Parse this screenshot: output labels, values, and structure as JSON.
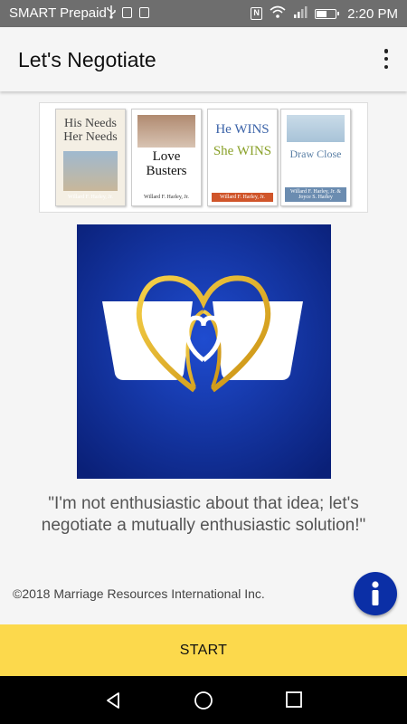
{
  "status_bar": {
    "carrier": "SMART Prepaid",
    "time": "2:20 PM",
    "nfc_label": "N"
  },
  "app_bar": {
    "title": "Let's Negotiate",
    "menu_icon": "more-vert-icon"
  },
  "books": [
    {
      "title_line1": "His Needs",
      "title_line2": "Her Needs",
      "author": "Willard F. Harley, Jr.",
      "cover_color": "#f4efe4"
    },
    {
      "title_line1": "Love",
      "title_line2": "Busters",
      "author": "Willard F. Harley, Jr.",
      "cover_color": "#ffffff"
    },
    {
      "title_line1": "He WINS",
      "title_line2": "She WINS",
      "author": "Willard F. Harley, Jr.",
      "cover_color": "#ffffff"
    },
    {
      "title_line1": "Draw Close",
      "title_line2": "",
      "author": "Willard F. Harley, Jr. & Joyce S. Harley",
      "cover_color": "#ffffff"
    }
  ],
  "logo": {
    "background": "#0d2f9e",
    "heart_color": "#e9b31c"
  },
  "quote": "\"I'm not enthusiastic about that idea; let's negotiate a mutually enthusiastic solution!\"",
  "copyright": "©2018 Marriage Resources International Inc.",
  "info_button": {
    "icon": "info-icon",
    "color": "#0b2fa6"
  },
  "start_button": {
    "label": "START",
    "color": "#fcd94c"
  },
  "nav_bar": {
    "back_icon": "back-icon",
    "home_icon": "home-icon",
    "recents_icon": "recents-icon"
  }
}
